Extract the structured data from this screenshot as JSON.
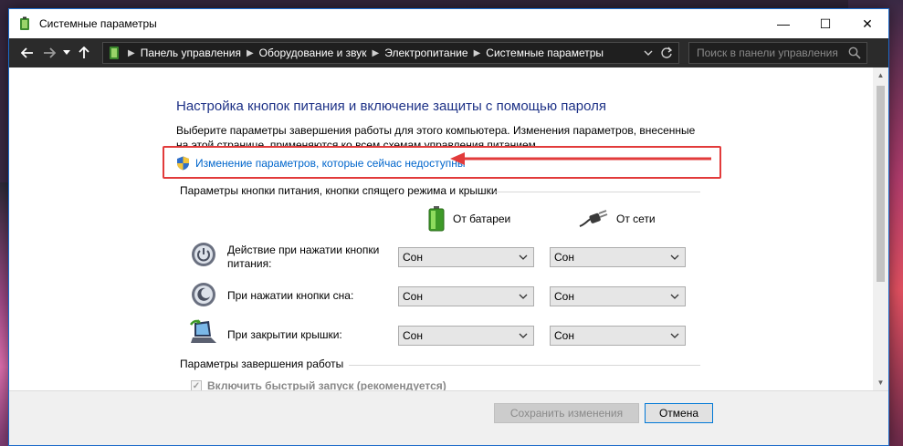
{
  "window": {
    "title": "Системные параметры"
  },
  "titlebar_buttons": {
    "minimize": "—",
    "maximize": "☐",
    "close": "✕"
  },
  "nav": {
    "breadcrumb": [
      "Панель управления",
      "Оборудование и звук",
      "Электропитание",
      "Системные параметры"
    ],
    "search_placeholder": "Поиск в панели управления"
  },
  "page": {
    "title": "Настройка кнопок питания и включение защиты с помощью пароля",
    "description": "Выберите параметры завершения работы для этого компьютера. Изменения параметров, внесенные на этой странице, применяются ко всем схемам управления питанием.",
    "change_link": "Изменение параметров, которые сейчас недоступны"
  },
  "power_buttons": {
    "section_title": "Параметры кнопки питания, кнопки спящего режима и крышки",
    "col_battery": "От батареи",
    "col_ac": "От сети",
    "rows": [
      {
        "label": "Действие при нажатии кнопки питания:",
        "battery": "Сон",
        "ac": "Сон"
      },
      {
        "label": "При нажатии кнопки сна:",
        "battery": "Сон",
        "ac": "Сон"
      },
      {
        "label": "При закрытии крышки:",
        "battery": "Сон",
        "ac": "Сон"
      }
    ]
  },
  "shutdown": {
    "section_title": "Параметры завершения работы",
    "fast_startup_label": "Включить быстрый запуск (рекомендуется)",
    "fast_startup_checked": true
  },
  "footer": {
    "save_label": "Сохранить изменения",
    "cancel_label": "Отмена"
  },
  "colors": {
    "title_blue": "#1e3287",
    "link_blue": "#0066cc",
    "highlight_red": "#e23b3b"
  }
}
